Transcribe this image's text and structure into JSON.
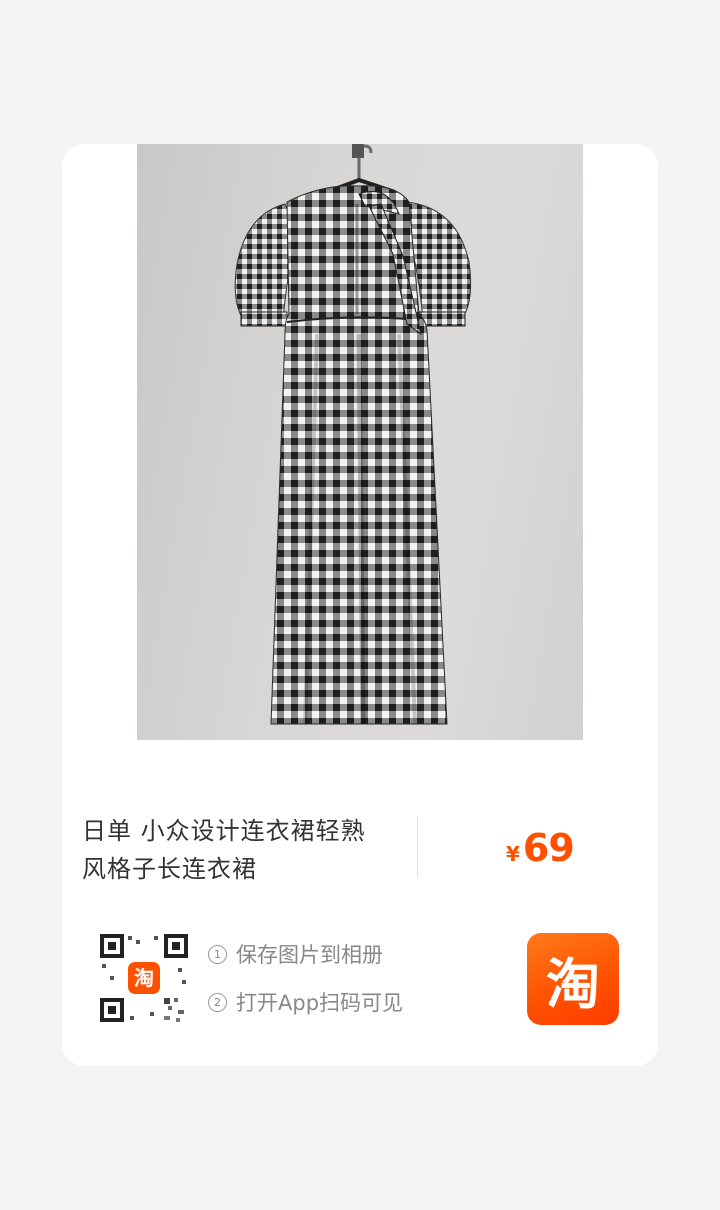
{
  "product": {
    "title_line1": "日单 小众设计连衣裙轻熟",
    "title_line2": "风格子长连衣裙",
    "image_icon": "checkered-dress-photo"
  },
  "price": {
    "currency": "¥",
    "value": "69"
  },
  "share": {
    "qr_badge": "淘",
    "step1_num": "1",
    "step1_label": "保存图片到相册",
    "step2_num": "2",
    "step2_label": "打开App扫码可见"
  },
  "app": {
    "logo_text": "淘",
    "brand_color": "#ff5000"
  }
}
